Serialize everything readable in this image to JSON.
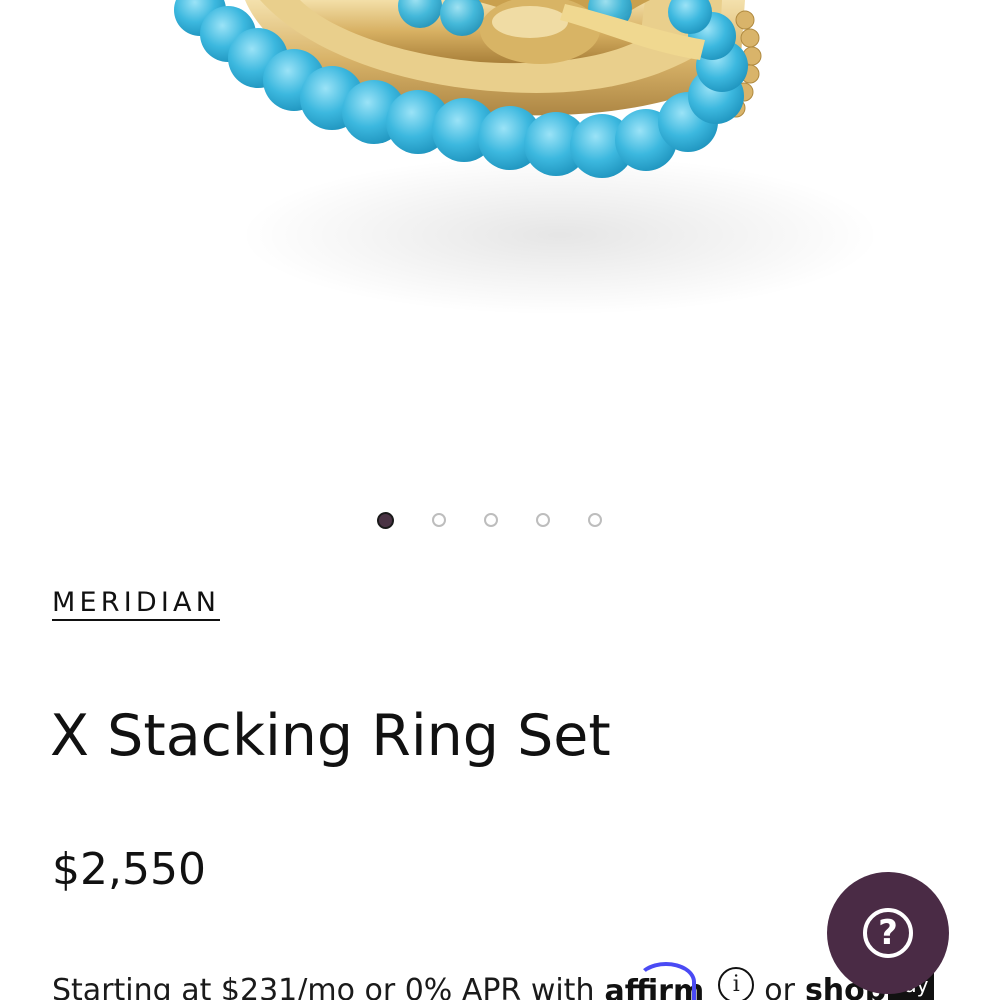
{
  "product": {
    "image_alt": "turquoise beaded and gold X stacking rings",
    "brand": "MERIDIAN",
    "title": "X Stacking Ring Set",
    "price": "$2,550"
  },
  "carousel": {
    "slide_count": 5,
    "active_index": 0
  },
  "financing": {
    "prefix": "Starting at $231/mo or 0% APR with",
    "affirm_label": "affirm",
    "info_symbol": "i",
    "connector": "or",
    "shop_label": "shop",
    "pay_label": "Pay"
  },
  "help": {
    "symbol": "?"
  },
  "colors": {
    "accent": "#4a2b45",
    "turquoise": "#3cb8df",
    "gold": "#d9b46a",
    "affirm_blue": "#4a4af4"
  }
}
